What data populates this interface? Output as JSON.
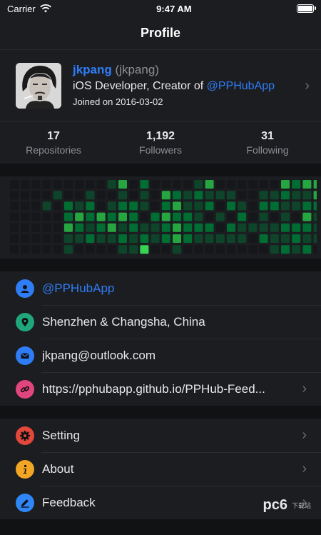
{
  "status_bar": {
    "carrier": "Carrier",
    "time": "9:47 AM"
  },
  "navbar": {
    "title": "Profile"
  },
  "profile": {
    "name": "jkpang",
    "login": "(jkpang)",
    "bio_prefix": "iOS Developer, Creator of ",
    "bio_handle": "@PPHubApp",
    "joined": "Joined on 2016-03-02"
  },
  "stats": [
    {
      "value": "17",
      "label": "Repositories"
    },
    {
      "value": "1,192",
      "label": "Followers"
    },
    {
      "value": "31",
      "label": "Following"
    }
  ],
  "contributions": {
    "colors": [
      "#16171a",
      "#0e4429",
      "#006d32",
      "#26a641",
      "#39d353"
    ],
    "weeks": [
      [
        0,
        0,
        0,
        0,
        0,
        0,
        0
      ],
      [
        0,
        0,
        0,
        0,
        0,
        0,
        0
      ],
      [
        0,
        0,
        0,
        0,
        0,
        0,
        0
      ],
      [
        0,
        0,
        1,
        0,
        0,
        0,
        0
      ],
      [
        0,
        1,
        0,
        0,
        0,
        0,
        0
      ],
      [
        0,
        0,
        2,
        2,
        3,
        1,
        1
      ],
      [
        0,
        0,
        1,
        3,
        2,
        1,
        0
      ],
      [
        0,
        1,
        2,
        2,
        1,
        2,
        0
      ],
      [
        0,
        0,
        0,
        3,
        2,
        1,
        0
      ],
      [
        1,
        0,
        1,
        2,
        3,
        1,
        0
      ],
      [
        3,
        1,
        2,
        3,
        1,
        2,
        1
      ],
      [
        0,
        0,
        2,
        2,
        2,
        1,
        1
      ],
      [
        2,
        1,
        1,
        0,
        1,
        2,
        4
      ],
      [
        0,
        0,
        0,
        2,
        1,
        1,
        0
      ],
      [
        0,
        3,
        2,
        3,
        2,
        2,
        0
      ],
      [
        0,
        2,
        3,
        2,
        3,
        3,
        1
      ],
      [
        0,
        1,
        1,
        2,
        2,
        2,
        0
      ],
      [
        1,
        2,
        1,
        1,
        2,
        1,
        0
      ],
      [
        3,
        1,
        2,
        0,
        2,
        1,
        0
      ],
      [
        0,
        1,
        0,
        1,
        0,
        1,
        0
      ],
      [
        0,
        1,
        2,
        0,
        2,
        1,
        0
      ],
      [
        0,
        0,
        1,
        2,
        1,
        1,
        0
      ],
      [
        0,
        0,
        0,
        0,
        1,
        0,
        0
      ],
      [
        0,
        1,
        2,
        1,
        1,
        2,
        0
      ],
      [
        0,
        1,
        2,
        0,
        1,
        1,
        1
      ],
      [
        3,
        2,
        1,
        1,
        2,
        1,
        2
      ],
      [
        2,
        1,
        1,
        0,
        2,
        2,
        1
      ],
      [
        3,
        1,
        2,
        3,
        2,
        1,
        2
      ],
      [
        3,
        3,
        2,
        1,
        1,
        1,
        0
      ]
    ]
  },
  "info_rows": [
    {
      "icon": "person-icon",
      "color": "#2f7df6",
      "label": "@PPHubApp",
      "link": true
    },
    {
      "icon": "location-icon",
      "color": "#1fa67a",
      "label": "Shenzhen & Changsha, China",
      "link": false
    },
    {
      "icon": "mail-icon",
      "color": "#2f7df6",
      "label": "jkpang@outlook.com",
      "link": false
    },
    {
      "icon": "link-icon",
      "color": "#e0457b",
      "label": "https://pphubapp.github.io/PPHub-Feed...",
      "link": false,
      "chevron": true
    }
  ],
  "menu_rows": [
    {
      "icon": "gear-icon",
      "color": "#e2473b",
      "label": "Setting"
    },
    {
      "icon": "info-icon",
      "color": "#f2a623",
      "label": "About"
    },
    {
      "icon": "pencil-icon",
      "color": "#2f86f6",
      "label": "Feedback"
    }
  ],
  "watermark": {
    "brand": "pc6",
    "sub": "下载站"
  }
}
